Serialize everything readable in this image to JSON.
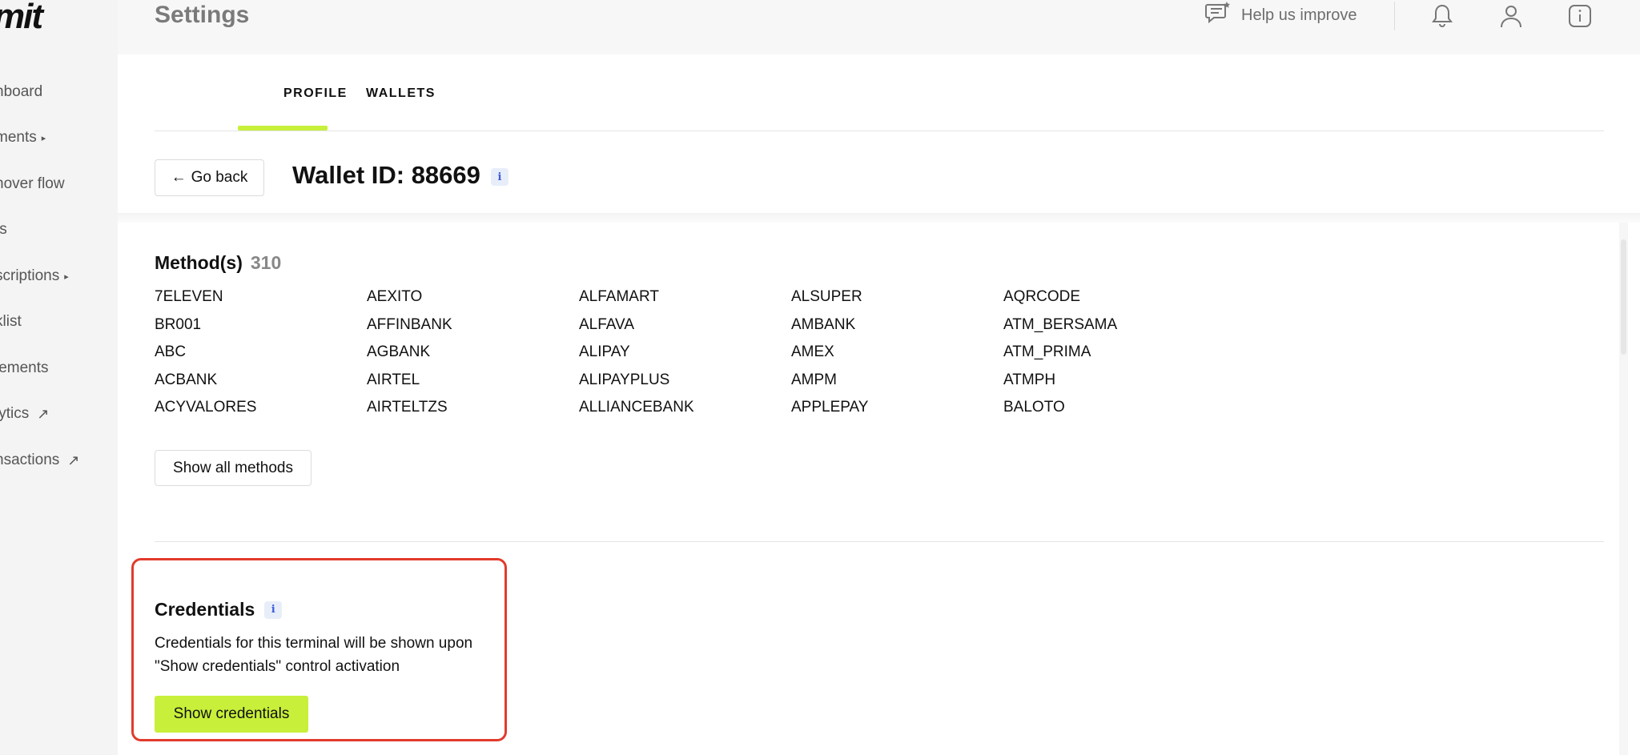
{
  "brand": {
    "logo_text": "mit"
  },
  "sidebar": {
    "items": [
      {
        "label": "nboard",
        "suffix": ""
      },
      {
        "label": "ments",
        "suffix": "caret"
      },
      {
        "label": "nover flow",
        "suffix": ""
      },
      {
        "label": "ts",
        "suffix": ""
      },
      {
        "label": "scriptions",
        "suffix": "caret"
      },
      {
        "label": "klist",
        "suffix": ""
      },
      {
        "label": "lements",
        "suffix": ""
      },
      {
        "label": "lytics",
        "suffix": "external"
      },
      {
        "label": "nsactions",
        "suffix": "external"
      }
    ]
  },
  "header": {
    "title": "Settings",
    "help_label": "Help us improve",
    "icons": [
      "bell-icon",
      "user-icon",
      "info-icon"
    ]
  },
  "tabs": [
    {
      "label": "PROFILE",
      "active": false
    },
    {
      "label": "WALLETS",
      "active": true
    }
  ],
  "wallet": {
    "back_label": "Go back",
    "title": "Wallet ID: 88669",
    "info_glyph": "i"
  },
  "methods": {
    "title": "Method(s)",
    "count": "310",
    "show_all_label": "Show all methods",
    "items": [
      "7ELEVEN",
      "AEXITO",
      "ALFAMART",
      "ALSUPER",
      "AQRCODE",
      "BR001",
      "AFFINBANK",
      "ALFAVA",
      "AMBANK",
      "ATM_BERSAMA",
      "ABC",
      "AGBANK",
      "ALIPAY",
      "AMEX",
      "ATM_PRIMA",
      "ACBANK",
      "AIRTEL",
      "ALIPAYPLUS",
      "AMPM",
      "ATMPH",
      "ACYVALORES",
      "AIRTELTZS",
      "ALLIANCEBANK",
      "APPLEPAY",
      "BALOTO"
    ]
  },
  "credentials": {
    "title": "Credentials",
    "info_glyph": "i",
    "description": "Credentials for this terminal will be shown upon \"Show credentials\" control activation",
    "button_label": "Show credentials"
  },
  "colors": {
    "accent": "#c8f03a",
    "highlight_border": "#e23a2c",
    "info_badge_bg": "#e8eef9",
    "info_badge_fg": "#3b5bdb"
  }
}
